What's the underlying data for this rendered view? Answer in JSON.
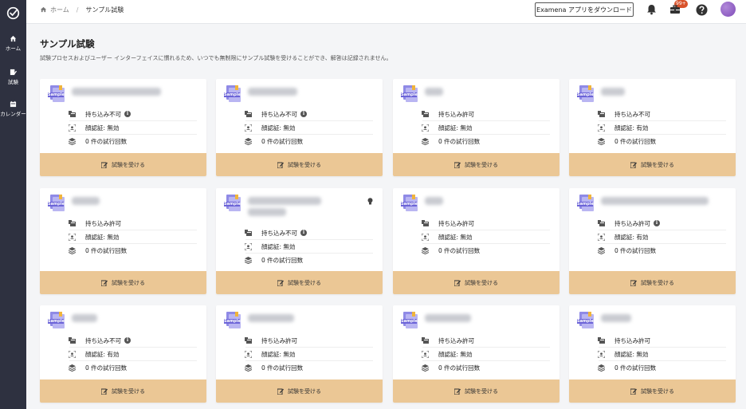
{
  "sidebar": {
    "items": [
      {
        "label": "ホーム",
        "icon": "home-icon"
      },
      {
        "label": "試験",
        "icon": "exam-icon"
      },
      {
        "label": "カレンダー",
        "icon": "calendar-icon"
      }
    ]
  },
  "header": {
    "breadcrumb_home": "ホーム",
    "breadcrumb_current": "サンプル試験",
    "download_label": "Examena アプリをダウンロード",
    "notification_badge": "99+"
  },
  "page": {
    "title": "サンプル試験",
    "description": "試験プロセスおよびユーザー インターフェイスに慣れるため、いつでも無制限にサンプル試験を受けることができ、解答は記録されません。"
  },
  "sample_label": "Sample",
  "button_label": "試験を受ける",
  "cards": [
    {
      "carry": "持ち込み不可",
      "info": true,
      "face": "顔認証: 無効",
      "attempts": "0 件の試行回数"
    },
    {
      "carry": "持ち込み不可",
      "info": true,
      "face": "顔認証: 無効",
      "attempts": "0 件の試行回数"
    },
    {
      "carry": "持ち込み許可",
      "info": false,
      "face": "顔認証: 無効",
      "attempts": "0 件の試行回数"
    },
    {
      "carry": "持ち込み不可",
      "info": false,
      "face": "顔認証: 有効",
      "attempts": "0 件の試行回数"
    },
    {
      "carry": "持ち込み許可",
      "info": false,
      "face": "顔認証: 無効",
      "attempts": "0 件の試行回数"
    },
    {
      "carry": "持ち込み不可",
      "info": true,
      "face": "顔認証: 無効",
      "attempts": "0 件の試行回数"
    },
    {
      "carry": "持ち込み許可",
      "info": false,
      "face": "顔認証: 無効",
      "attempts": "0 件の試行回数"
    },
    {
      "carry": "持ち込み許可",
      "info": true,
      "face": "顔認証: 有効",
      "attempts": "0 件の試行回数"
    },
    {
      "carry": "持ち込み不可",
      "info": true,
      "face": "顔認証: 有効",
      "attempts": "0 件の試行回数"
    },
    {
      "carry": "持ち込み許可",
      "info": false,
      "face": "顔認証: 無効",
      "attempts": "0 件の試行回数"
    },
    {
      "carry": "持ち込み許可",
      "info": false,
      "face": "顔認証: 無効",
      "attempts": "0 件の試行回数"
    },
    {
      "carry": "持ち込み許可",
      "info": false,
      "face": "顔認証: 無効",
      "attempts": "0 件の試行回数"
    }
  ],
  "colors": {
    "sidebar": "#2e3140",
    "button": "#ebc795",
    "badge": "#d9532b",
    "sample_icon": "#6c64d8"
  }
}
